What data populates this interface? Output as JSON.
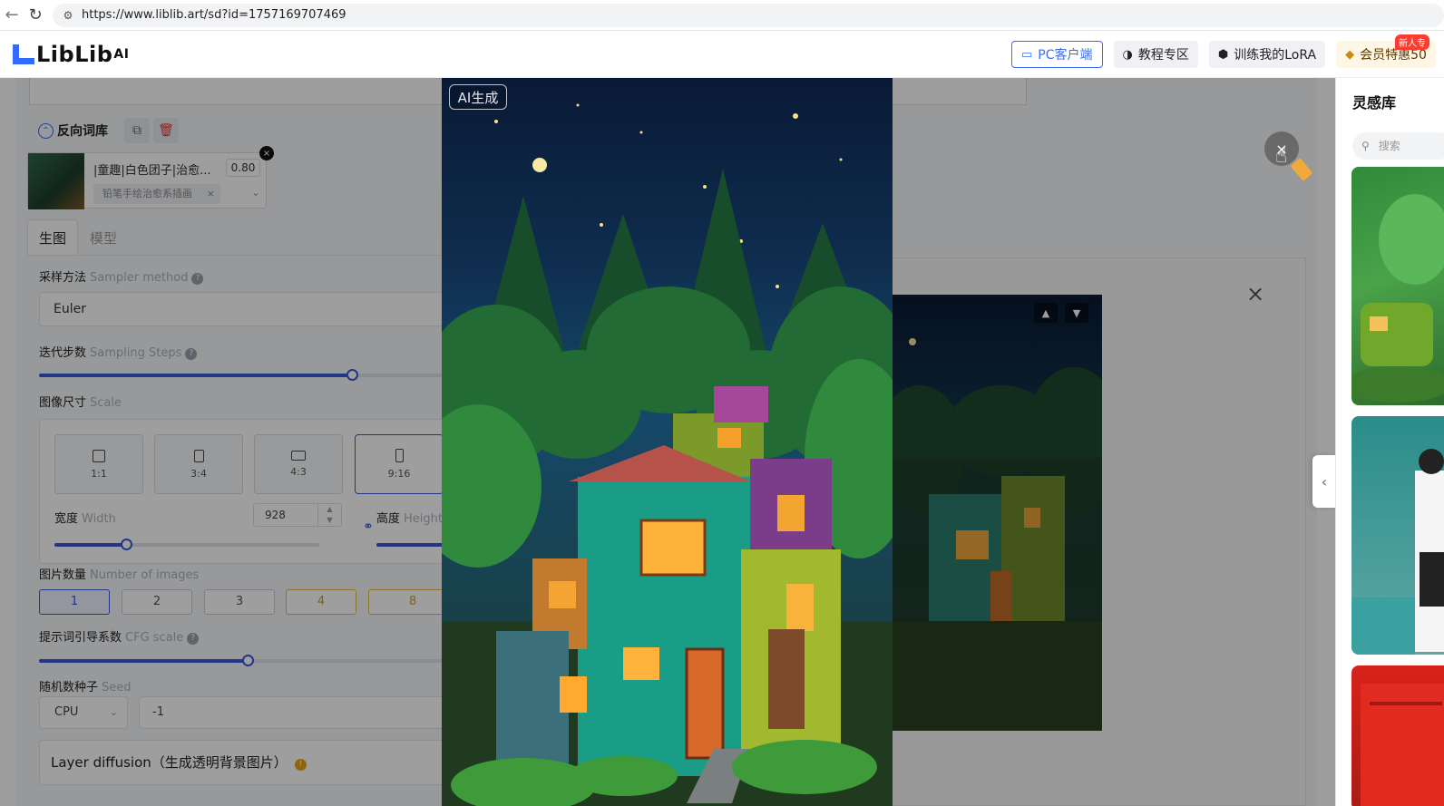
{
  "browser": {
    "back_icon": "back-arrow-icon",
    "reload_icon": "reload-icon",
    "url": "https://www.liblib.art/sd?id=1757169707469"
  },
  "header": {
    "logo_text": "LibLib",
    "logo_sup": "AI",
    "buttons": [
      {
        "label": "PC客户端",
        "icon": "monitor-download-icon"
      },
      {
        "label": "教程专区",
        "icon": "palette-icon"
      },
      {
        "label": "训练我的LoRA",
        "icon": "cube-icon"
      },
      {
        "label": "会员特惠50",
        "icon": "diamond-icon"
      }
    ],
    "new_badge": "新人专"
  },
  "form": {
    "negative_title": "反向词库",
    "lora": {
      "name": "|童趣|白色团子|治愈...",
      "weight": "0.80",
      "tag": "铅笔手绘治愈系插画"
    },
    "tabs": [
      "生图",
      "模型"
    ],
    "sampler": {
      "label": "采样方法",
      "en": "Sampler method",
      "value": "Euler"
    },
    "steps": {
      "label": "迭代步数",
      "en": "Sampling Steps",
      "fraction": 0.75
    },
    "scale": {
      "label": "图像尺寸",
      "en": "Scale",
      "ratios": [
        "1:1",
        "3:4",
        "4:3",
        "9:16"
      ],
      "active_ratio": "9:16",
      "width_label": "宽度",
      "width_en": "Width",
      "width_value": "928",
      "height_label": "高度",
      "height_en": "Height",
      "width_fraction": 0.27
    },
    "count": {
      "label": "图片数量",
      "en": "Number of images",
      "options": [
        "1",
        "2",
        "3",
        "4",
        "8"
      ],
      "active": "1"
    },
    "cfg": {
      "label": "提示词引导系数",
      "en": "CFG scale",
      "fraction": 0.5
    },
    "seed": {
      "label": "随机数种子",
      "en": "Seed",
      "device": "CPU",
      "value": "-1"
    },
    "layer_diffusion": "Layer diffusion（生成透明背景图片）"
  },
  "preview": {
    "badge": "AI生成"
  },
  "inspiration": {
    "title": "灵感库",
    "search_placeholder": "搜索"
  }
}
